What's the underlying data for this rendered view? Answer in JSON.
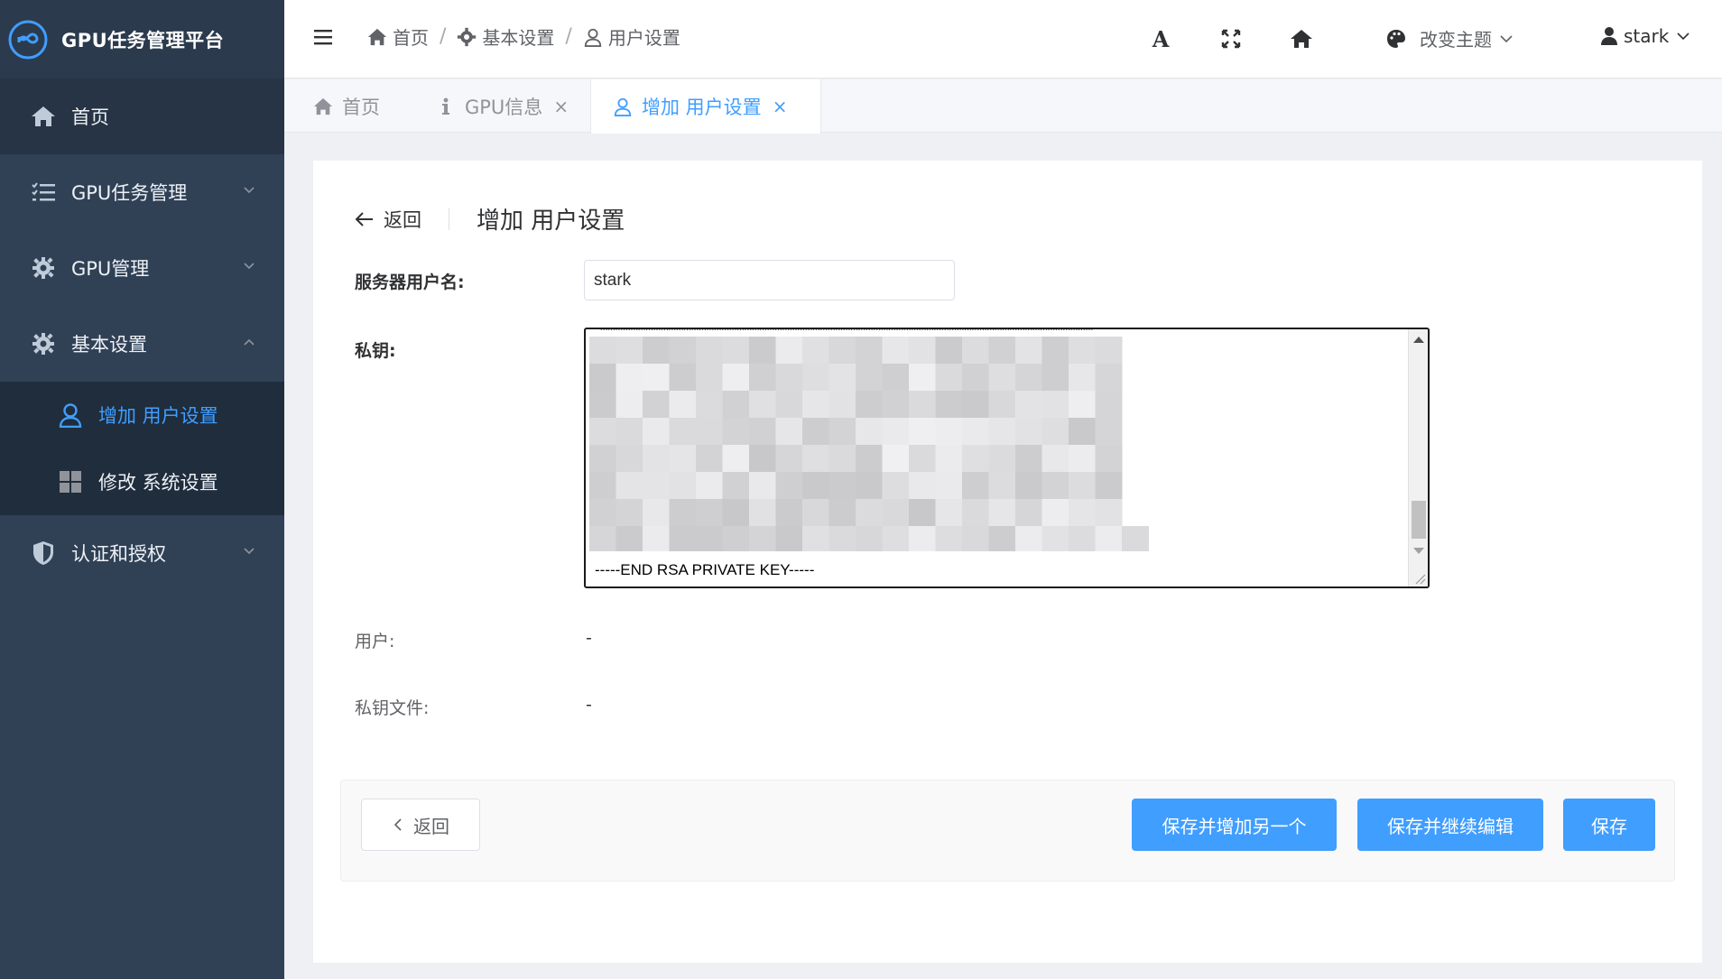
{
  "app": {
    "title": "GPU任务管理平台"
  },
  "sidebar": {
    "items": [
      {
        "label": "首页"
      },
      {
        "label": "GPU任务管理"
      },
      {
        "label": "GPU管理"
      },
      {
        "label": "基本设置"
      },
      {
        "label": "认证和授权"
      }
    ],
    "basic_settings_children": [
      {
        "label": "增加 用户设置"
      },
      {
        "label": "修改 系统设置"
      }
    ]
  },
  "navbar": {
    "breadcrumb": [
      {
        "label": "首页"
      },
      {
        "label": "基本设置"
      },
      {
        "label": "用户设置"
      }
    ],
    "breadcrumb_sep": "/",
    "font_toggle": "A",
    "theme_label": "改变主题",
    "username": "stark"
  },
  "tabs": [
    {
      "label": "首页"
    },
    {
      "label": "GPU信息",
      "close": "×"
    },
    {
      "label": "增加 用户设置",
      "close": "×"
    }
  ],
  "page": {
    "back_label": "返回",
    "title": "增加 用户设置"
  },
  "form": {
    "server_username_label": "服务器用户名:",
    "server_username_value": "stark",
    "private_key_label": "私钥:",
    "private_key_end_line": "-----END RSA PRIVATE KEY-----",
    "user_label": "用户:",
    "user_value": "-",
    "key_file_label": "私钥文件:",
    "key_file_value": "-"
  },
  "actions": {
    "back": "返回",
    "save_add_another": "保存并增加另一个",
    "save_continue": "保存并继续编辑",
    "save": "保存"
  },
  "colors": {
    "sidebar_bg": "#304156",
    "accent": "#409eff"
  }
}
